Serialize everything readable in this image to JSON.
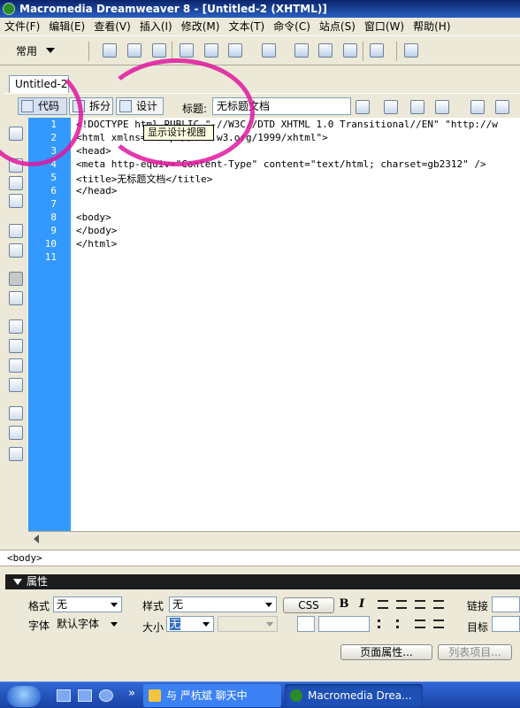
{
  "window": {
    "title": "Macromedia Dreamweaver 8 - [Untitled-2 (XHTML)]"
  },
  "menu": [
    "文件(F)",
    "编辑(E)",
    "查看(V)",
    "插入(I)",
    "修改(M)",
    "文本(T)",
    "命令(C)",
    "站点(S)",
    "窗口(W)",
    "帮助(H)"
  ],
  "insert_bar": {
    "category": "常用"
  },
  "document": {
    "tab": "Untitled-2",
    "code_view_label": "代码",
    "split_view_label": "拆分",
    "design_view_label": "设计",
    "title_label": "标题:",
    "title_value": "无标题文档",
    "tooltip": "显示设计视图"
  },
  "code": {
    "line_numbers": [
      "1",
      "2",
      "3",
      "4",
      "5",
      "6",
      "7",
      "8",
      "9",
      "10",
      "11"
    ],
    "lines": [
      "<!DOCTYPE html PUBLIC \"-//W3C//DTD XHTML 1.0 Transitional//EN\" \"http://w",
      "<html xmlns=\"http://www.w3.org/1999/xhtml\">",
      "<head>",
      "<meta http-equiv=\"Content-Type\" content=\"text/html; charset=gb2312\" />",
      "<title>无标题文档</title>",
      "</head>",
      "",
      "<body>",
      "</body>",
      "</html>",
      ""
    ]
  },
  "tag_selector": "<body>",
  "properties": {
    "header": "属性",
    "format_label": "格式",
    "format_value": "无",
    "style_label": "样式",
    "style_value": "无",
    "css_button": "CSS",
    "bold": "B",
    "italic": "I",
    "link_label": "链接",
    "font_label": "字体",
    "font_value": "默认字体",
    "size_label": "大小",
    "size_value": "无",
    "target_label": "目标",
    "page_props_button": "页面属性...",
    "list_item_button": "列表项目..."
  },
  "taskbar": {
    "items": [
      {
        "label": "与 严杭斌 聊天中"
      },
      {
        "label": "Macromedia Drea..."
      }
    ],
    "more": "»"
  },
  "colors": {
    "gutter": "#3399ff",
    "highlight": "#e0179e",
    "title_bar": "#0a246a"
  }
}
